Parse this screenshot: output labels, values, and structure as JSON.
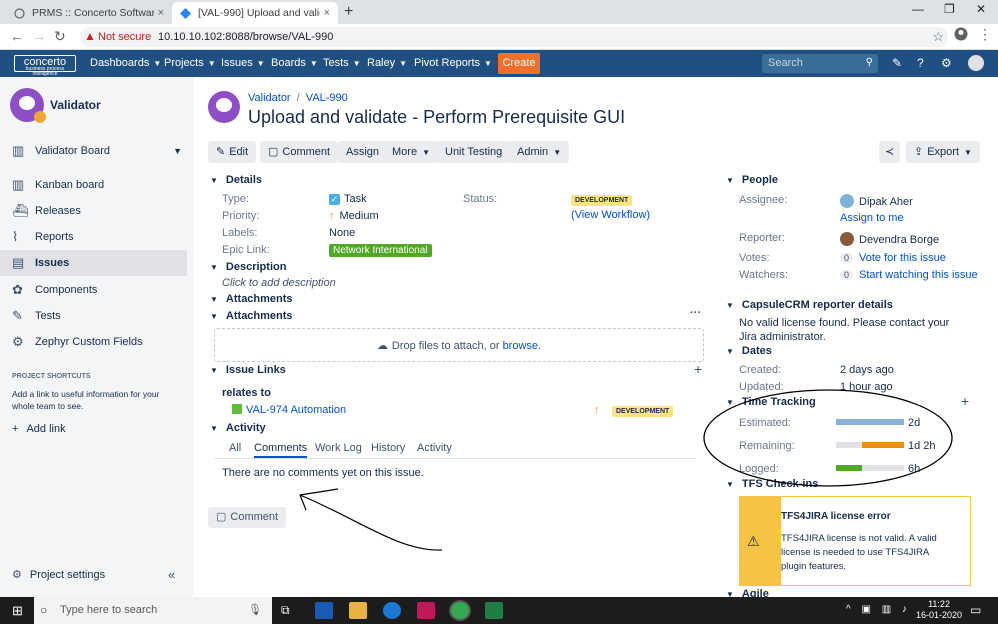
{
  "browser": {
    "tabs": [
      {
        "title": "PRMS :: Concerto Software & Sys",
        "close": "×"
      },
      {
        "title": "[VAL-990] Upload and validate - ",
        "close": "×"
      }
    ],
    "new_tab": "+",
    "window_controls": [
      "—",
      "❐",
      "✕"
    ],
    "security_label": "Not secure",
    "url": "10.10.10.102:8088/browse/VAL-990"
  },
  "jira_nav": {
    "logo_text": "concerto",
    "logo_subtext": "business process intelligence",
    "menus": [
      "Dashboards",
      "Projects",
      "Issues",
      "Boards",
      "Tests",
      "Raley",
      "Pivot Reports"
    ],
    "create_label": "Create",
    "search_placeholder": "Search"
  },
  "sidebar": {
    "project_name": "Validator",
    "items": [
      {
        "label": "Validator Board",
        "icon": "board-icon"
      },
      {
        "label": "Kanban board",
        "icon": "kanban-icon"
      },
      {
        "label": "Releases",
        "icon": "ship-icon"
      },
      {
        "label": "Reports",
        "icon": "chart-icon"
      },
      {
        "label": "Issues",
        "icon": "issues-icon"
      },
      {
        "label": "Components",
        "icon": "components-icon"
      },
      {
        "label": "Tests",
        "icon": "tests-icon"
      },
      {
        "label": "Zephyr Custom Fields",
        "icon": "gear-icon"
      }
    ],
    "shortcuts_heading": "PROJECT SHORTCUTS",
    "shortcuts_text": "Add a link to useful information for your whole team to see.",
    "add_link": "Add link",
    "project_settings": "Project settings"
  },
  "issue": {
    "breadcrumb_project": "Validator",
    "breadcrumb_sep": "/",
    "breadcrumb_key": "VAL-990",
    "title": "Upload and validate - Perform Prerequisite GUI",
    "toolbar": {
      "edit": "Edit",
      "comment": "Comment",
      "assign": "Assign",
      "more": "More",
      "unit_testing": "Unit Testing",
      "admin": "Admin",
      "export": "Export"
    },
    "details": {
      "heading": "Details",
      "type_label": "Type:",
      "type_value": "Task",
      "status_label": "Status:",
      "status_value": "DEVELOPMENT",
      "view_workflow": "(View Workflow)",
      "priority_label": "Priority:",
      "priority_value": "Medium",
      "labels_label": "Labels:",
      "labels_value": "None",
      "epic_label": "Epic Link:",
      "epic_value": "Network International"
    },
    "description": {
      "heading": "Description",
      "placeholder": "Click to add description"
    },
    "attachments_heading_1": "Attachments",
    "attachments_heading_2": "Attachments",
    "dropzone_text": "Drop files to attach, or",
    "dropzone_link": "browse.",
    "issue_links": {
      "heading": "Issue Links",
      "relation": "relates to",
      "linked_key": "VAL-974",
      "linked_summary": "Automation",
      "linked_status": "DEVELOPMENT"
    },
    "activity": {
      "heading": "Activity",
      "tabs": [
        "All",
        "Comments",
        "Work Log",
        "History",
        "Activity"
      ],
      "active_tab": "Comments",
      "empty_text": "There are no comments yet on this issue.",
      "comment_button": "Comment"
    }
  },
  "right_panel": {
    "people": {
      "heading": "People",
      "assignee_label": "Assignee:",
      "assignee_value": "Dipak Aher",
      "assign_to_me": "Assign to me",
      "reporter_label": "Reporter:",
      "reporter_value": "Devendra Borge",
      "votes_label": "Votes:",
      "votes_count": "0",
      "votes_link": "Vote for this issue",
      "watchers_label": "Watchers:",
      "watchers_count": "0",
      "watchers_link": "Start watching this issue"
    },
    "capsule": {
      "heading": "CapsuleCRM reporter details",
      "text": "No valid license found. Please contact your Jira administrator."
    },
    "dates": {
      "heading": "Dates",
      "created_label": "Created:",
      "created_value": "2 days ago",
      "updated_label": "Updated:",
      "updated_value": "1 hour ago"
    },
    "time_tracking": {
      "heading": "Time Tracking",
      "estimated_label": "Estimated:",
      "estimated_value": "2d",
      "estimated_fraction": 1.0,
      "remaining_label": "Remaining:",
      "remaining_value": "1d 2h",
      "remaining_fraction": 0.625,
      "logged_label": "Logged:",
      "logged_value": "6h",
      "logged_fraction": 0.375
    },
    "tfs": {
      "heading": "TFS Check-ins",
      "error_title": "TFS4JIRA license error",
      "error_text": "TFS4JIRA license is not valid. A valid license is needed to use TFS4JIRA plugin features."
    },
    "agile_heading": "Agile"
  },
  "taskbar": {
    "search_placeholder": "Type here to search",
    "time": "11:22",
    "date": "16-01-2020"
  },
  "colors": {
    "jira_nav": "#205081",
    "create": "#f0702b",
    "estimated_bar": "#89b0d8",
    "remaining_bar": "#ec8e00",
    "logged_bar": "#51a825",
    "status_lozenge": "#ffe380"
  }
}
